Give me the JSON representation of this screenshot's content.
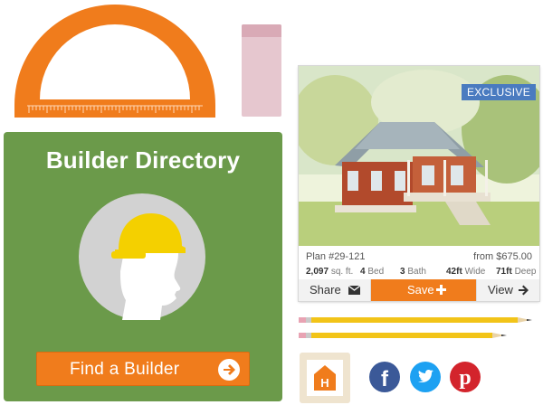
{
  "builder_directory": {
    "title": "Builder Directory",
    "button_label": "Find a Builder",
    "colors": {
      "card": "#6b9a4a",
      "button": "#f07c1c",
      "helmet": "#f4d000"
    }
  },
  "plan_card": {
    "badge": "EXCLUSIVE",
    "plan_number": "Plan #29-121",
    "price": "from $675.00",
    "sqft_value": "2,097",
    "sqft_unit": "sq. ft.",
    "beds_value": "4",
    "beds_unit": "Bed",
    "baths_value": "3",
    "baths_unit": "Bath",
    "width_value": "42ft",
    "width_unit": "Wide",
    "depth_value": "71ft",
    "depth_unit": "Deep",
    "actions": {
      "share": "Share",
      "save": "Save",
      "view": "View"
    }
  },
  "icons": {
    "protractor": "protractor-icon",
    "eraser": "eraser-icon",
    "pencil": "pencil-icon",
    "houzz": "houzz-icon",
    "facebook": "facebook-icon",
    "twitter": "twitter-icon",
    "pinterest": "pinterest-icon"
  },
  "social_letters": {
    "houzz": "H",
    "facebook": "f",
    "pinterest": "p"
  }
}
